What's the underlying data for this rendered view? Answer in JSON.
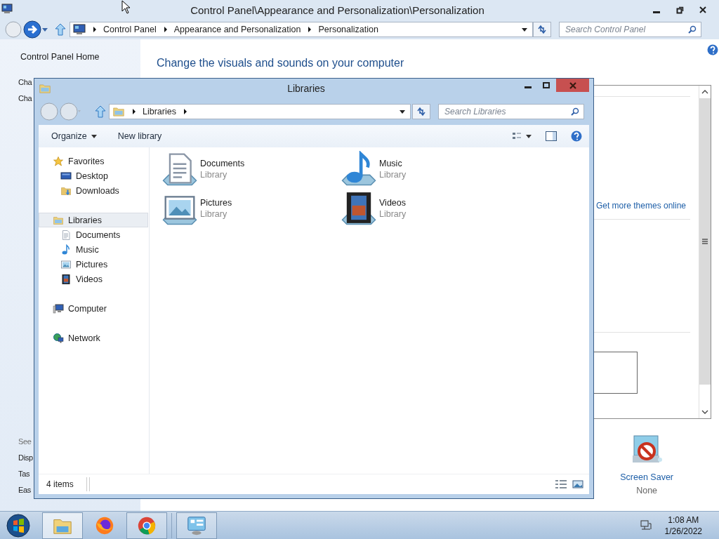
{
  "control_panel": {
    "title": "Control Panel\\Appearance and Personalization\\Personalization",
    "breadcrumb": [
      "Control Panel",
      "Appearance and Personalization",
      "Personalization"
    ],
    "search": {
      "placeholder": "Search Control Panel"
    },
    "sidebar": {
      "home": "Control Panel Home",
      "links": [
        "Cha",
        "Cha"
      ],
      "see_also": "See",
      "see_also_links": [
        "Disp",
        "Tas",
        "Eas"
      ]
    },
    "heading": "Change the visuals and sounds on your computer",
    "themes_link": "Get more themes online",
    "screen_saver": {
      "label": "Screen Saver",
      "value": "None"
    }
  },
  "libraries_window": {
    "title": "Libraries",
    "breadcrumb": [
      "Libraries"
    ],
    "search": {
      "placeholder": "Search Libraries"
    },
    "toolbar": {
      "organize": "Organize",
      "new_library": "New library"
    },
    "nav": [
      {
        "label": "Favorites",
        "kind": "star",
        "selected": false,
        "children": [
          {
            "label": "Desktop",
            "kind": "desktop",
            "selected": false
          },
          {
            "label": "Downloads",
            "kind": "downloads",
            "selected": false
          }
        ]
      },
      {
        "label": "Libraries",
        "kind": "library",
        "selected": true,
        "children": [
          {
            "label": "Documents",
            "kind": "documents",
            "selected": false
          },
          {
            "label": "Music",
            "kind": "music",
            "selected": false
          },
          {
            "label": "Pictures",
            "kind": "pictures",
            "selected": false
          },
          {
            "label": "Videos",
            "kind": "videos",
            "selected": false
          }
        ]
      },
      {
        "label": "Computer",
        "kind": "computer",
        "selected": false
      },
      {
        "label": "Network",
        "kind": "network",
        "selected": false
      }
    ],
    "items": [
      {
        "name": "Documents",
        "type": "Library",
        "kind": "documents"
      },
      {
        "name": "Music",
        "type": "Library",
        "kind": "music"
      },
      {
        "name": "Pictures",
        "type": "Library",
        "kind": "pictures"
      },
      {
        "name": "Videos",
        "type": "Library",
        "kind": "videos"
      }
    ],
    "status": "4 items"
  },
  "taskbar": {
    "buttons": [
      {
        "kind": "explorer",
        "running": true,
        "selected": true
      },
      {
        "kind": "firefox",
        "running": false,
        "selected": false
      },
      {
        "kind": "chrome",
        "running": true,
        "selected": false
      },
      {
        "kind": "control-panel",
        "running": true,
        "selected": false
      }
    ],
    "clock": {
      "time": "1:08 AM",
      "date": "1/26/2022"
    }
  }
}
